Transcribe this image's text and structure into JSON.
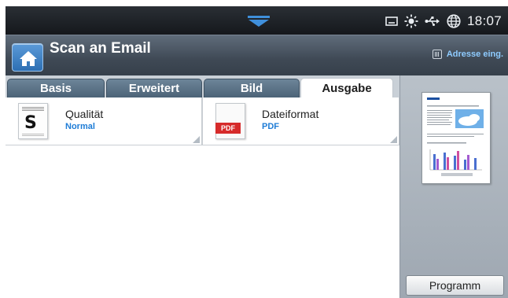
{
  "statusbar": {
    "time": "18:07",
    "icons": [
      "pull-down-tab-icon",
      "storage-icon",
      "brightness-icon",
      "usb-icon",
      "network-globe-icon"
    ]
  },
  "header": {
    "title": "Scan an Email",
    "home_icon": "home-icon",
    "address_button_label": "Adresse eing."
  },
  "tabs": [
    {
      "label": "Basis",
      "active": false
    },
    {
      "label": "Erweitert",
      "active": false
    },
    {
      "label": "Bild",
      "active": false
    },
    {
      "label": "Ausgabe",
      "active": true
    }
  ],
  "options": [
    {
      "label": "Qualität",
      "value": "Normal",
      "icon": "document-quality-icon",
      "icon_letter": "S"
    },
    {
      "label": "Dateiformat",
      "value": "PDF",
      "icon": "pdf-file-icon",
      "icon_badge": "PDF"
    }
  ],
  "sidepanel": {
    "program_button_label": "Programm",
    "preview_icon": "document-preview-thumbnail"
  },
  "colors": {
    "accent_blue": "#1e7cd6",
    "tab_active_bg": "#ffffff",
    "tab_inactive_bg": "#5a7185",
    "header_bg": "#434d59",
    "pdf_red": "#d62b2b"
  }
}
